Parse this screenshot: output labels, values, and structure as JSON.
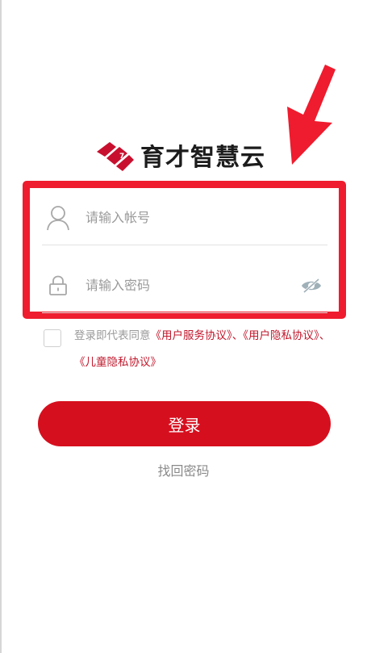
{
  "app": {
    "logo_text": "育才智慧云"
  },
  "login_form": {
    "account_placeholder": "请输入帐号",
    "password_placeholder": "请输入密码",
    "agreement": {
      "prefix": "登录即代表同意",
      "user_service": "《用户服务协议》",
      "sep1": "、",
      "user_privacy": "《用户隐私协议》",
      "sep2": "、",
      "child_privacy": "《儿童隐私协议》"
    },
    "login_label": "登录",
    "forgot_label": "找回密码"
  },
  "icons": {
    "account": "user-icon",
    "password": "lock-icon",
    "toggle": "eye-hidden-icon",
    "annotation": "arrow-annotation-icon"
  },
  "colors": {
    "brand_red": "#d60f1e",
    "highlight_red": "#ee1c2e",
    "link_red": "#c0182c",
    "placeholder_gray": "#9a9a9a"
  }
}
